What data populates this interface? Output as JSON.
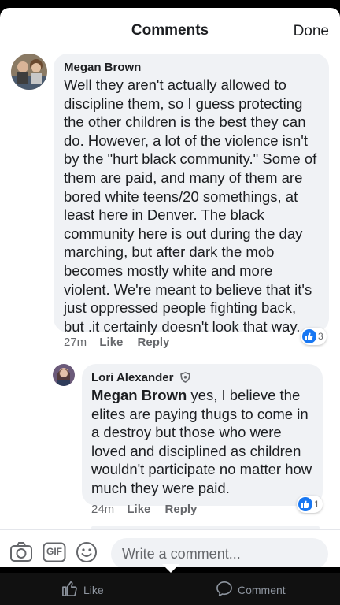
{
  "header": {
    "title": "Comments",
    "done_label": "Done"
  },
  "comments": [
    {
      "author": "Megan Brown",
      "text": "Well they aren't actually allowed to discipline them, so I guess protecting the other children is the best they can do. However, a lot of the violence isn't by the \"hurt black community.\" Some of them are paid, and many of them are bored white teens/20 somethings, at least here in Denver. The black community here is out during the day marching, but after dark the mob becomes mostly white and more violent. We're meant to believe that it's just oppressed people fighting back, but .it certainly doesn't look that way.",
      "time": "27m",
      "like_label": "Like",
      "reply_label": "Reply",
      "reaction_count": "3"
    },
    {
      "author": "Lori Alexander",
      "mention": "Megan Brown",
      "text": " yes, I believe the elites are paying thugs to come in a destroy but those who were loved and disciplined as children wouldn't participate no matter how much they were paid.",
      "time": "24m",
      "like_label": "Like",
      "reply_label": "Reply",
      "reaction_count": "1"
    }
  ],
  "composer": {
    "placeholder": "Write a comment...",
    "gif_label": "GIF"
  },
  "bottom_bar": {
    "like_label": "Like",
    "comment_label": "Comment"
  },
  "colors": {
    "accent": "#1877f2",
    "bubble": "#f0f2f5",
    "muted": "#65676b"
  }
}
